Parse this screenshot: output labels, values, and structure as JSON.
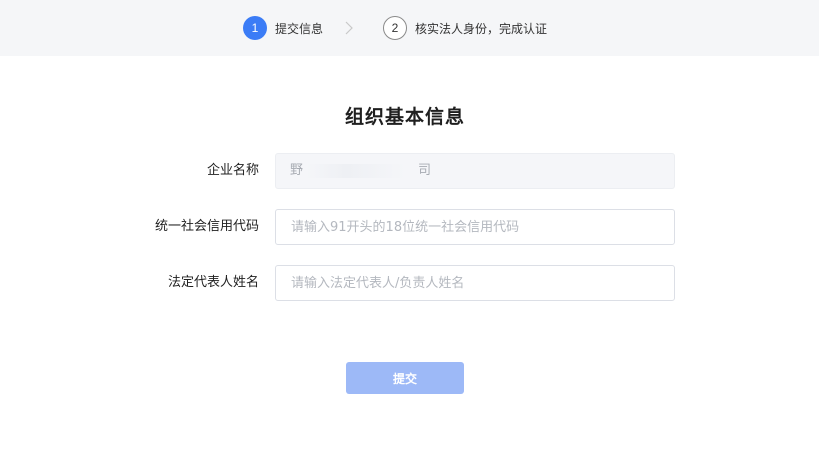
{
  "stepper": {
    "steps": [
      {
        "number": "1",
        "label": "提交信息",
        "state": "active"
      },
      {
        "number": "2",
        "label": "核实法人身份，完成认证",
        "state": "inactive"
      }
    ],
    "separator_icon": "chevron-right-icon"
  },
  "form": {
    "title": "组织基本信息",
    "fields": [
      {
        "label": "企业名称",
        "value_prefix": "野",
        "value_suffix": "司",
        "disabled": true
      },
      {
        "label": "统一社会信用代码",
        "placeholder": "请输入91开头的18位统一社会信用代码"
      },
      {
        "label": "法定代表人姓名",
        "placeholder": "请输入法定代表人/负责人姓名"
      }
    ],
    "submit_label": "提交"
  },
  "colors": {
    "accent": "#3b7cf6",
    "submit_disabled": "#9db9f7",
    "stepper_bg": "#f5f6f8"
  }
}
